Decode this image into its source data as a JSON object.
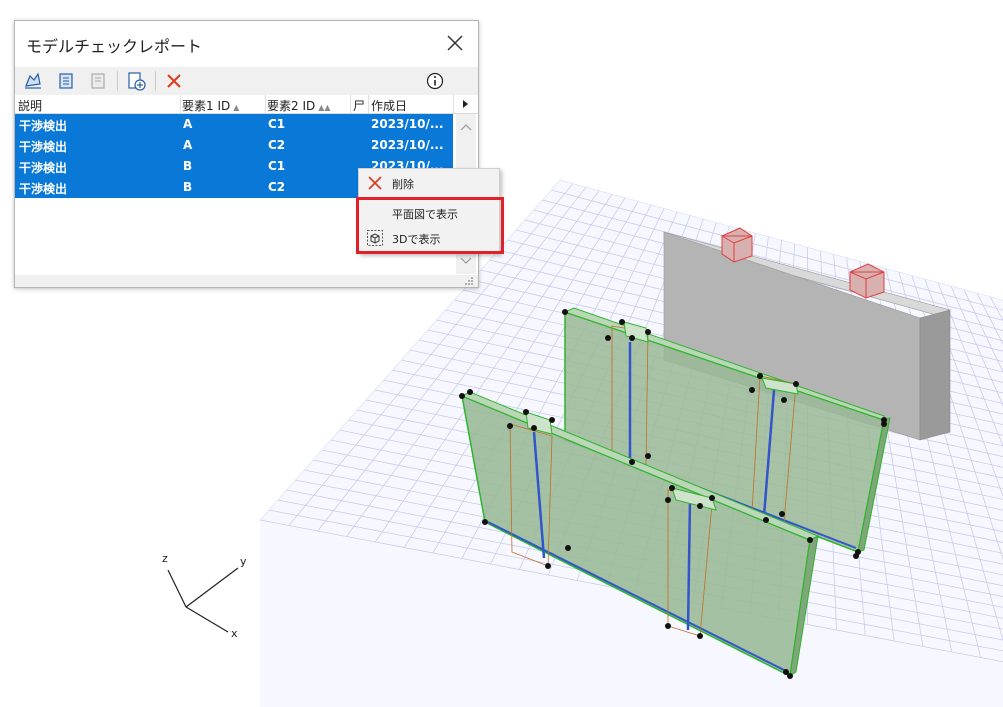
{
  "dialog": {
    "title": "モデルチェックレポート",
    "columns": [
      {
        "label": "説明"
      },
      {
        "label": "要素1 ID"
      },
      {
        "label": "要素2 ID"
      },
      {
        "label": "尸"
      },
      {
        "label": "作成日"
      }
    ],
    "rows": [
      {
        "desc": "干渉検出",
        "id1": "A",
        "id2": "C1",
        "date": "2023/10/..."
      },
      {
        "desc": "干渉検出",
        "id1": "A",
        "id2": "C2",
        "date": "2023/10/..."
      },
      {
        "desc": "干渉検出",
        "id1": "B",
        "id2": "C1",
        "date": "2023/10/..."
      },
      {
        "desc": "干渉検出",
        "id1": "B",
        "id2": "C2",
        "date": ""
      }
    ],
    "selection_color": "#0a78d7"
  },
  "context_menu": {
    "items": [
      {
        "label": "削除",
        "icon": "delete-x-icon"
      },
      {
        "label": "平面図で表示",
        "icon": ""
      },
      {
        "label": "3Dで表示",
        "icon": "3d-view-icon"
      }
    ],
    "highlight_color": "#e0202a"
  },
  "axes": {
    "x": "x",
    "y": "y",
    "z": "z"
  },
  "colors": {
    "grid": "#c7ceea",
    "wall_green": "#8fb38a",
    "wall_gray": "#b4b4b4",
    "edge_green": "#2db52d",
    "edge_blue": "#3355cc",
    "red_box": "#e04040"
  }
}
